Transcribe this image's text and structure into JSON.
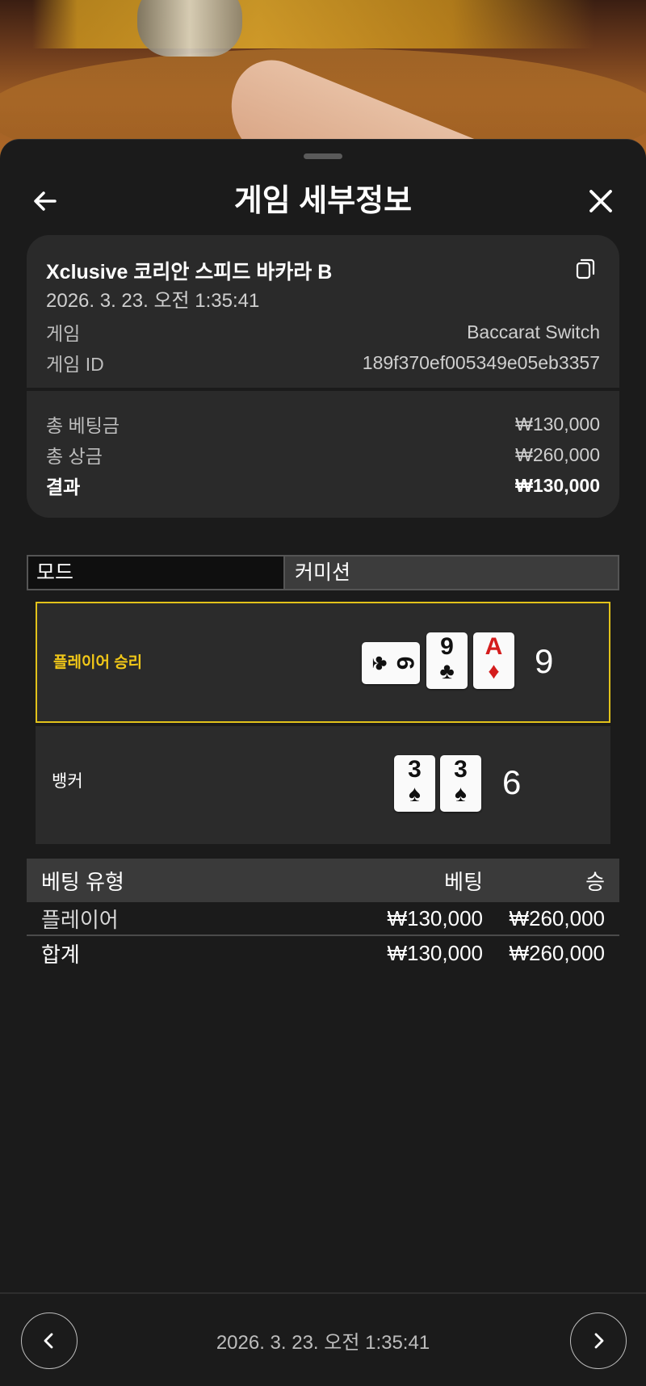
{
  "header": {
    "title": "게임 세부정보"
  },
  "game_info": {
    "name": "Xclusive 코리안 스피드 바카라 B",
    "datetime": "2026. 3. 23. 오전 1:35:41",
    "game_label": "게임",
    "game_value": "Baccarat Switch",
    "game_id_label": "게임 ID",
    "game_id_value": "189f370ef005349e05eb3357"
  },
  "summary": {
    "total_bet_label": "총 베팅금",
    "total_bet_value": "₩130,000",
    "total_win_label": "총 상금",
    "total_win_value": "₩260,000",
    "result_label": "결과",
    "result_value": "₩130,000"
  },
  "mode_bar": {
    "mode_label": "모드",
    "mode_value": "커미션"
  },
  "hands": {
    "player": {
      "label": "플레이어 승리",
      "score": "9",
      "cards": [
        {
          "rank": "6",
          "suit": "♣",
          "color": "#111111",
          "sideways": true
        },
        {
          "rank": "9",
          "suit": "♣",
          "color": "#111111",
          "sideways": false
        },
        {
          "rank": "A",
          "suit": "♦",
          "color": "#d41d1d",
          "sideways": false
        }
      ]
    },
    "banker": {
      "label": "뱅커",
      "score": "6",
      "cards": [
        {
          "rank": "3",
          "suit": "♠",
          "color": "#111111"
        },
        {
          "rank": "3",
          "suit": "♠",
          "color": "#111111"
        }
      ]
    }
  },
  "bet_table": {
    "headers": {
      "type": "베팅 유형",
      "bet": "베팅",
      "win": "승"
    },
    "rows": [
      {
        "type": "플레이어",
        "bet": "₩130,000",
        "win": "₩260,000"
      }
    ],
    "total": {
      "type": "합계",
      "bet": "₩130,000",
      "win": "₩260,000"
    }
  },
  "footer": {
    "datetime": "2026. 3. 23. 오전 1:35:41"
  },
  "icons": [
    "back-arrow-icon",
    "close-icon",
    "copy-icon",
    "chevron-left-icon",
    "chevron-right-icon"
  ],
  "colors": {
    "accent_yellow": "#f2c818",
    "sheet_bg": "#1b1b1b",
    "card_bg": "#2a2a2a"
  }
}
